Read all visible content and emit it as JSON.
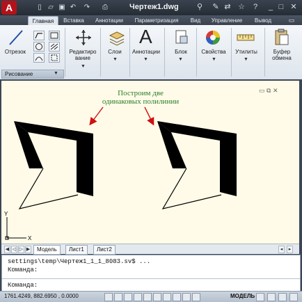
{
  "title_bar": {
    "document_title": "Чертеж1.dwg",
    "app_logo": "A"
  },
  "tabs": [
    "Главная",
    "Вставка",
    "Аннотации",
    "Параметризация",
    "Вид",
    "Управление",
    "Вывод"
  ],
  "ribbon": {
    "line_tool": "Отрезок",
    "draw_panel_label": "Рисование",
    "modify": "Редактиро\nвание",
    "layers": "Слои",
    "annotations": "Аннотации",
    "block": "Блок",
    "properties": "Свойства",
    "utilities": "Утилиты",
    "clipboard": "Буфер\nобмена"
  },
  "drawing": {
    "annotation_line1": "Построим две",
    "annotation_line2": "одинаковых полилинии",
    "arrow_color": "#d01010",
    "annotation_color": "#2a7d2a",
    "ucs_x": "X",
    "ucs_y": "Y"
  },
  "layout_tabs": [
    "Модель",
    "Лист1",
    "Лист2"
  ],
  "command_line": {
    "line1": "settings\\temp\\Чертеж1_1_1_8083.sv$ ...",
    "line2": "Команда:",
    "prompt": "Команда:"
  },
  "status": {
    "coords": "1761.4249, 882.6950 , 0.0000",
    "model": "МОДЕЛЬ"
  },
  "icons": [
    "app-logo-icon",
    "new-icon",
    "open-icon",
    "save-icon",
    "undo-icon",
    "redo-icon",
    "print-icon",
    "binoculars-icon",
    "star-icon",
    "help-icon"
  ]
}
